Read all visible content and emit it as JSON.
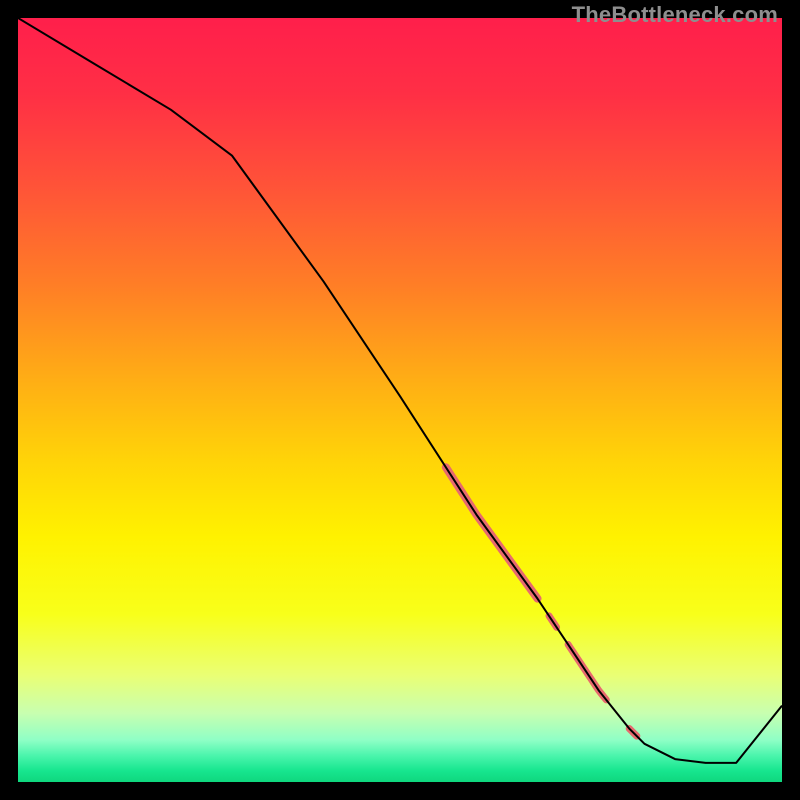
{
  "watermark": "TheBottleneck.com",
  "chart_data": {
    "type": "line",
    "title": "",
    "xlabel": "",
    "ylabel": "",
    "xlim": [
      0,
      100
    ],
    "ylim": [
      0,
      100
    ],
    "grid": false,
    "x": [
      0,
      10,
      20,
      28,
      40,
      50,
      60,
      68,
      72,
      76,
      80,
      82,
      86,
      90,
      94,
      100
    ],
    "values": [
      100,
      94,
      88,
      82,
      65.5,
      50.5,
      35,
      24,
      18,
      12,
      7,
      5,
      3,
      2.5,
      2.5,
      10
    ],
    "highlight_segments": [
      {
        "x0": 56,
        "x1": 68,
        "width": 8
      },
      {
        "x0": 69.5,
        "x1": 70.5,
        "width": 7
      },
      {
        "x0": 72,
        "x1": 77,
        "width": 7
      },
      {
        "x0": 80,
        "x1": 81,
        "width": 7
      }
    ],
    "highlight_color": "#e76a6e",
    "gradient_stops": [
      {
        "offset": 0.0,
        "color": "#ff1f4b"
      },
      {
        "offset": 0.1,
        "color": "#ff2f45"
      },
      {
        "offset": 0.22,
        "color": "#ff5338"
      },
      {
        "offset": 0.35,
        "color": "#ff7e26"
      },
      {
        "offset": 0.48,
        "color": "#ffb014"
      },
      {
        "offset": 0.58,
        "color": "#ffd408"
      },
      {
        "offset": 0.68,
        "color": "#fff200"
      },
      {
        "offset": 0.78,
        "color": "#f8ff1a"
      },
      {
        "offset": 0.86,
        "color": "#eaff74"
      },
      {
        "offset": 0.91,
        "color": "#c8ffb0"
      },
      {
        "offset": 0.945,
        "color": "#8fffc6"
      },
      {
        "offset": 0.965,
        "color": "#4cf5ad"
      },
      {
        "offset": 0.985,
        "color": "#17e68f"
      },
      {
        "offset": 1.0,
        "color": "#0fd77e"
      }
    ]
  }
}
